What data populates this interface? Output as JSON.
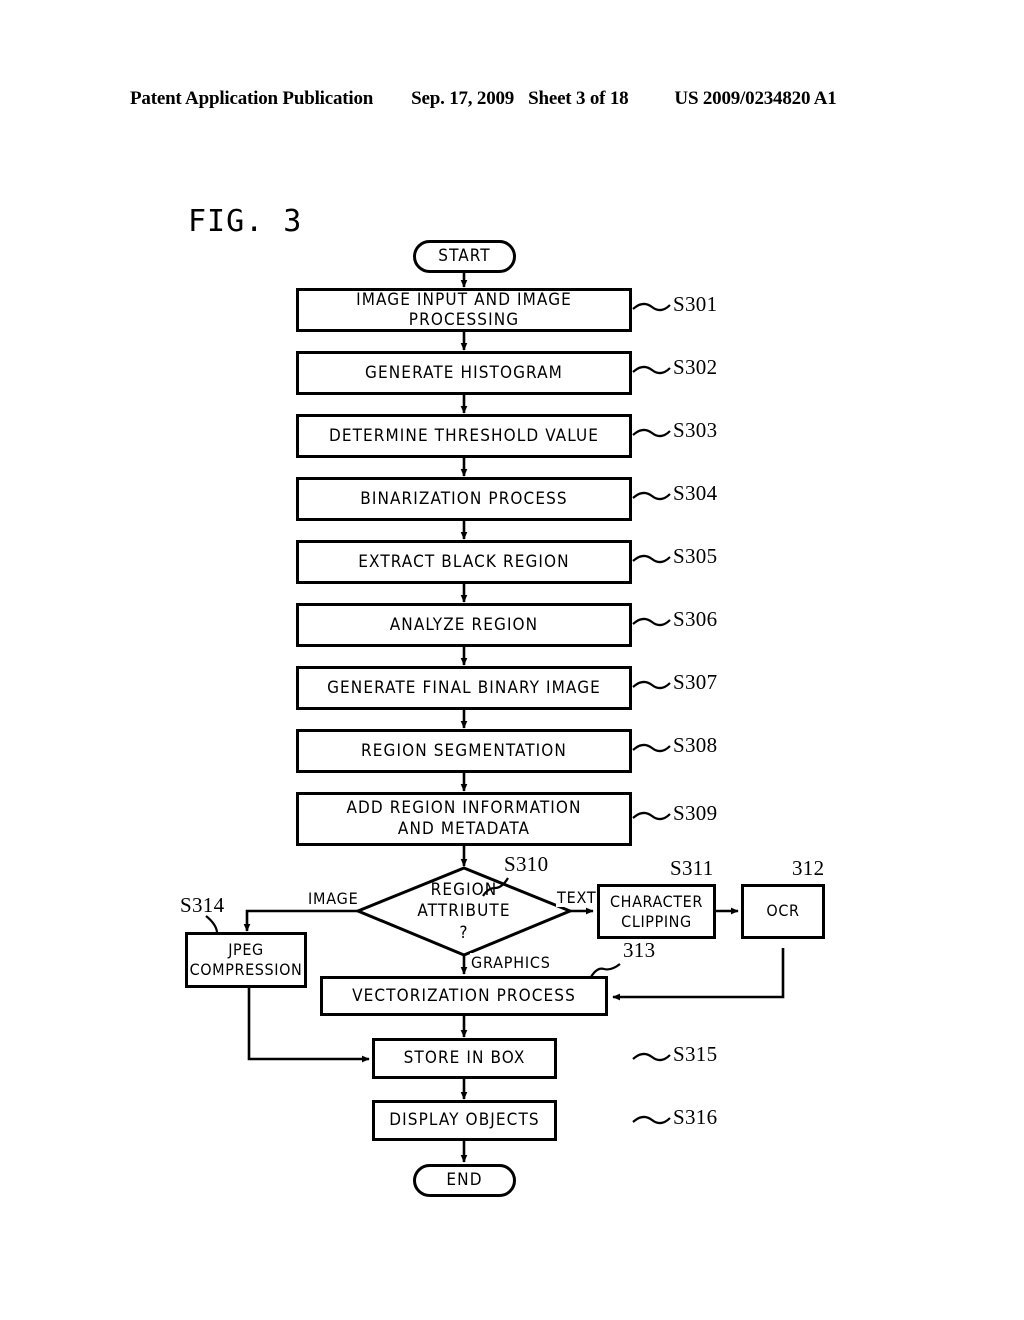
{
  "header": {
    "publication": "Patent Application Publication",
    "date": "Sep. 17, 2009",
    "sheet": "Sheet 3 of 18",
    "number": "US 2009/0234820 A1"
  },
  "figure": {
    "title": "FIG. 3",
    "type": "flowchart"
  },
  "flow": {
    "start_label": "START",
    "end_label": "END",
    "steps": [
      {
        "id": "s301",
        "text": "IMAGE INPUT AND IMAGE PROCESSING",
        "ref": "S301"
      },
      {
        "id": "s302",
        "text": "GENERATE HISTOGRAM",
        "ref": "S302"
      },
      {
        "id": "s303",
        "text": "DETERMINE THRESHOLD VALUE",
        "ref": "S303"
      },
      {
        "id": "s304",
        "text": "BINARIZATION PROCESS",
        "ref": "S304"
      },
      {
        "id": "s305",
        "text": "EXTRACT BLACK REGION",
        "ref": "S305"
      },
      {
        "id": "s306",
        "text": "ANALYZE REGION",
        "ref": "S306"
      },
      {
        "id": "s307",
        "text": "GENERATE FINAL BINARY IMAGE",
        "ref": "S307"
      },
      {
        "id": "s308",
        "text": "REGION SEGMENTATION",
        "ref": "S308"
      }
    ],
    "s309": {
      "line1": "ADD REGION INFORMATION",
      "line2": "AND METADATA",
      "ref": "S309"
    },
    "decision": {
      "line1": "REGION",
      "line2": "ATTRIBUTE",
      "line3": "?",
      "ref": "S310",
      "branch_image": "IMAGE",
      "branch_text": "TEXT",
      "branch_graphics": "GRAPHICS"
    },
    "jpeg": {
      "line1": "JPEG",
      "line2": "COMPRESSION",
      "ref": "S314"
    },
    "character_clipping": {
      "line1": "CHARACTER",
      "line2": "CLIPPING",
      "ref": "S311"
    },
    "ocr": {
      "text": "OCR",
      "ref": "312"
    },
    "vectorization": {
      "text": "VECTORIZATION PROCESS",
      "ref": "313"
    },
    "store": {
      "text": "STORE IN BOX",
      "ref": "S315"
    },
    "display": {
      "text": "DISPLAY OBJECTS",
      "ref": "S316"
    }
  },
  "colors": {
    "ink": "#000000",
    "paper": "#ffffff"
  }
}
